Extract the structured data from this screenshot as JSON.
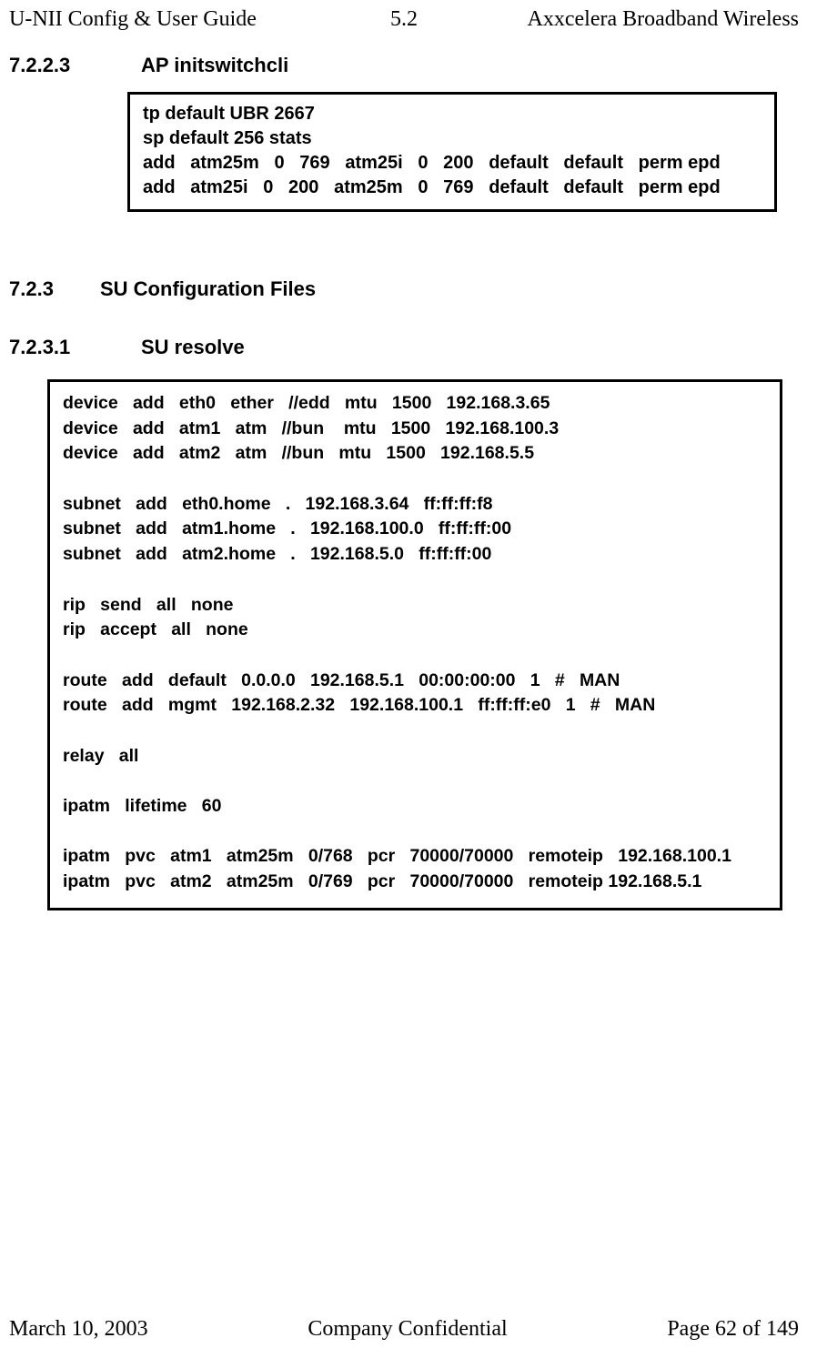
{
  "header": {
    "left": "U-NII Config & User Guide",
    "center": "5.2",
    "right": "Axxcelera Broadband Wireless"
  },
  "sections": {
    "s1": {
      "num": "7.2.2.3",
      "title": "AP initswitchcli"
    },
    "s2": {
      "num": "7.2.3",
      "title": "SU Configuration Files"
    },
    "s3": {
      "num": "7.2.3.1",
      "title": "SU resolve"
    }
  },
  "code1": "tp default UBR 2667\nsp default 256 stats\nadd   atm25m   0   769   atm25i   0   200   default   default   perm epd\nadd   atm25i   0   200   atm25m   0   769   default   default   perm epd",
  "code2": "device   add   eth0   ether   //edd   mtu   1500   192.168.3.65\ndevice   add   atm1   atm   //bun    mtu   1500   192.168.100.3\ndevice   add   atm2   atm   //bun   mtu   1500   192.168.5.5\n\nsubnet   add   eth0.home   .   192.168.3.64   ff:ff:ff:f8\nsubnet   add   atm1.home   .   192.168.100.0   ff:ff:ff:00\nsubnet   add   atm2.home   .   192.168.5.0   ff:ff:ff:00\n\nrip   send   all   none\nrip   accept   all   none\n\nroute   add   default   0.0.0.0   192.168.5.1   00:00:00:00   1   #   MAN\nroute   add   mgmt   192.168.2.32   192.168.100.1   ff:ff:ff:e0   1   #   MAN\n\nrelay   all\n\nipatm   lifetime   60\n\nipatm   pvc   atm1   atm25m   0/768   pcr   70000/70000   remoteip   192.168.100.1\nipatm   pvc   atm2   atm25m   0/769   pcr   70000/70000   remoteip 192.168.5.1",
  "footer": {
    "left": "March 10, 2003",
    "center": "Company Confidential",
    "right": "Page 62 of 149"
  }
}
